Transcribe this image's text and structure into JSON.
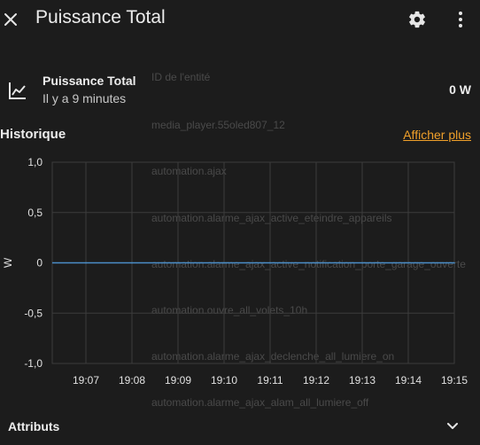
{
  "dialog": {
    "title": "Puissance Total"
  },
  "entity": {
    "name": "Puissance Total",
    "time": "Il y a 9 minutes",
    "value": "0 W"
  },
  "ghost_items": [
    "ID de l'entité",
    "media_player.55oled807_12",
    "automation.ajax",
    "automation.alarme_ajax_active_eteindre_appareils",
    "automation.alarme_ajax_active_notification_porte_garage_ouverte",
    "automation.ouvre_all_volets_10h",
    "automation.alarme_ajax_declenche_all_lumiere_on",
    "automation.alarme_ajax_alam_all_lumiere_off"
  ],
  "history": {
    "title": "Historique",
    "more_label": "Afficher plus"
  },
  "chart_data": {
    "type": "line",
    "x": [
      "19:07",
      "19:08",
      "19:09",
      "19:10",
      "19:11",
      "19:12",
      "19:13",
      "19:14",
      "19:15"
    ],
    "series": [
      {
        "values": [
          0,
          0,
          0,
          0,
          0,
          0,
          0,
          0,
          0
        ]
      }
    ],
    "ylabel": "W",
    "y_ticks": [
      "1,0",
      "0,5",
      "0",
      "-0,5",
      "-1,0"
    ],
    "ylim": [
      -1,
      1
    ],
    "grid": true,
    "line_color": "#4b8ec8"
  },
  "attributes": {
    "label": "Attributs"
  },
  "colors": {
    "background": "#1c1c1c",
    "accent_link": "#f0a02a",
    "grid": "#3c3c3c"
  }
}
